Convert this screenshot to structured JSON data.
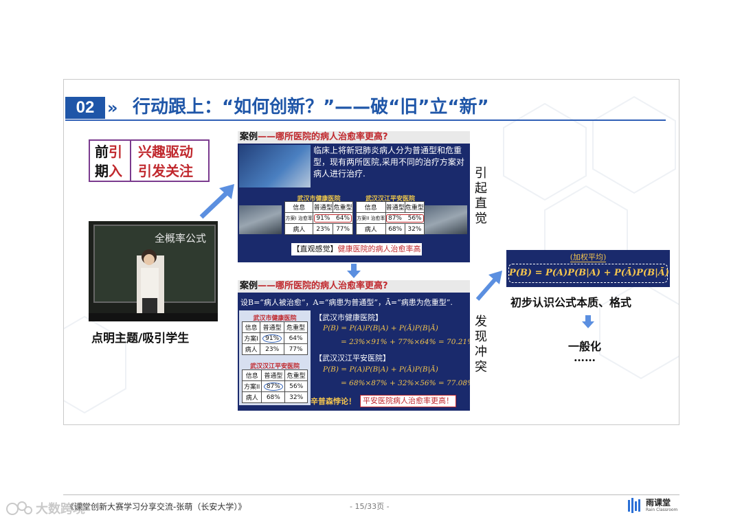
{
  "slide": {
    "number": "02",
    "title": "行动跟上：“如何创新？”——破“旧”立“新”",
    "intro": {
      "left_line1_a": "前",
      "left_line1_b": "引",
      "left_line2_a": "期",
      "left_line2_b": "入",
      "right_line1": "兴趣驱动",
      "right_line2": "引发关注"
    },
    "photo_board_text": "全概率公式",
    "photo_caption": "点明主题/吸引学生",
    "panel1": {
      "header_key": "案例",
      "header_rest": "——哪所医院的病人治愈率更高?",
      "description": "临床上将新冠肺炎病人分为普通型和危重型，现有两所医院,采用不同的治疗方案对病人进行治疗.",
      "hospital_a": "武汉市健康医院",
      "hospital_b": "武汉汉江平安医院",
      "table_header": [
        "信息",
        "普通型",
        "危重型"
      ],
      "row1_label": "方案I 治愈率",
      "row1_label_b": "方案II 治愈率",
      "a_row1": [
        "91%",
        "64%"
      ],
      "a_row2_label": "病人",
      "a_row2": [
        "23%",
        "77%"
      ],
      "b_row1": [
        "87%",
        "56%"
      ],
      "b_row2_label": "病人",
      "b_row2": [
        "68%",
        "32%"
      ],
      "conclusion_a": "【直观感觉】",
      "conclusion_b": "健康医院的病人治愈率高"
    },
    "vertical_1": [
      "引",
      "起",
      "直",
      "觉"
    ],
    "panel2": {
      "header_key": "案例",
      "header_rest": "——哪所医院的病人治愈率更高?",
      "setup": "设B=“病人被治愈”，A=“病患为普通型”，Ā=“病患为危重型”.",
      "hospital_a": "武汉市健康医院",
      "hospital_b": "武汉汉江平安医院",
      "table_header": [
        "信息",
        "普通型",
        "危重型"
      ],
      "a_row1_label": "方案I",
      "a_row1": [
        "91%",
        "64%"
      ],
      "a_row2_label": "病人",
      "a_row2": [
        "23%",
        "77%"
      ],
      "b_row1_label": "方案II",
      "b_row1": [
        "87%",
        "56%"
      ],
      "b_row2_label": "病人",
      "b_row2": [
        "68%",
        "32%"
      ],
      "calc_a_title": "【武汉市健康医院】",
      "calc_a_line1": "P(B) = P(A)P(B|A) + P(Ā)P(B|Ā)",
      "calc_a_line2": "= 23%×91% + 77%×64% = 70.21%",
      "calc_b_title": "【武汉汉江平安医院】",
      "calc_b_line1": "P(B) = P(A)P(B|A) + P(Ā)P(B|Ā)",
      "calc_b_line2": "= 68%×87% + 32%×56% = 77.08%",
      "simpson": "辛普森悖论！",
      "simpson_box": "平安医院病人治愈率更高！"
    },
    "vertical_2": [
      "发",
      "现",
      "冲",
      "突"
    ],
    "formula": {
      "title": "(加权平均)",
      "equation": "P(B) = P(A)P(B|A) + P(Ā)P(B|Ā)"
    },
    "right_caption_1": "初步认识公式本质、格式",
    "right_caption_2": "一般化",
    "right_caption_3": "……"
  },
  "footer": {
    "left": "《课堂创新大赛学习分享交流-张萌（长安大学）》",
    "page": "- 15/33页 -",
    "logo_name": "雨课堂",
    "logo_sub": "Rain Classroom",
    "watermark": "大数跨境"
  },
  "colors": {
    "primary_blue": "#1f56a8",
    "panel_navy": "#1a2a6c",
    "accent_red": "#c0282d",
    "accent_gold": "#f3c44e",
    "intro_border": "#7a3a8e"
  },
  "icons": [
    "double-chevron-right-icon",
    "arrow-up-right-icon",
    "arrow-down-icon",
    "rain-classroom-logo-icon",
    "watermark-logo-icon"
  ]
}
